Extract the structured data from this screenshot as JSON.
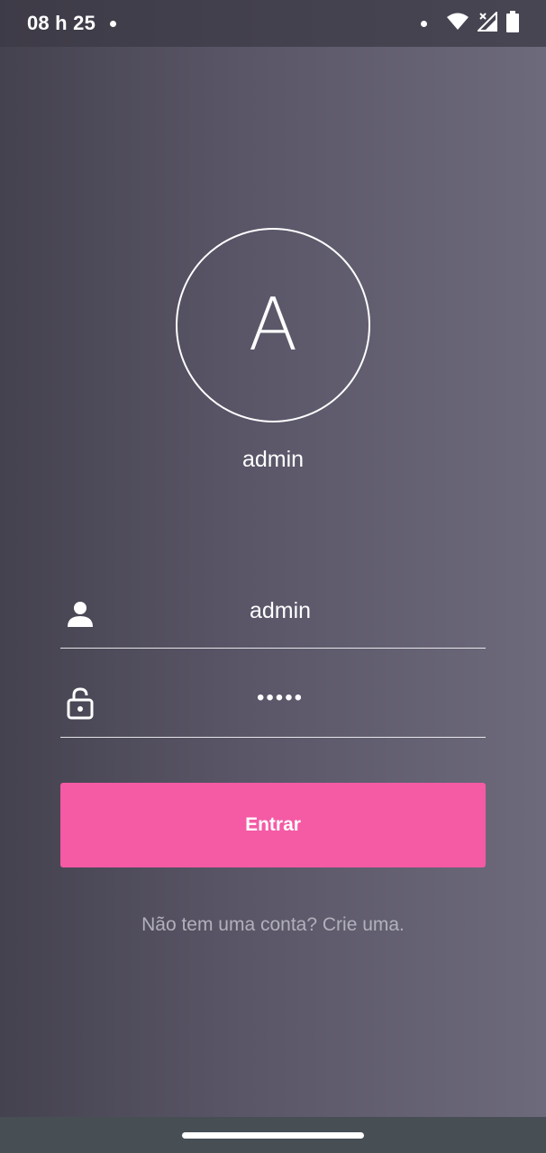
{
  "status_bar": {
    "time": "08 h 25",
    "icons": [
      "notification-dot-icon",
      "wifi-icon",
      "signal-icon",
      "battery-icon"
    ]
  },
  "profile": {
    "initial": "A",
    "name": "admin"
  },
  "form": {
    "username_icon": "person-icon",
    "username_value": "admin",
    "password_icon": "unlock-icon",
    "password_value": "•••••",
    "submit_label": "Entrar"
  },
  "signup": {
    "text": "Não tem uma conta? Crie uma."
  },
  "colors": {
    "accent": "#f55aa5",
    "background_start": "#45424f",
    "background_end": "#6d6a7c",
    "nav_bar": "#474f55"
  }
}
